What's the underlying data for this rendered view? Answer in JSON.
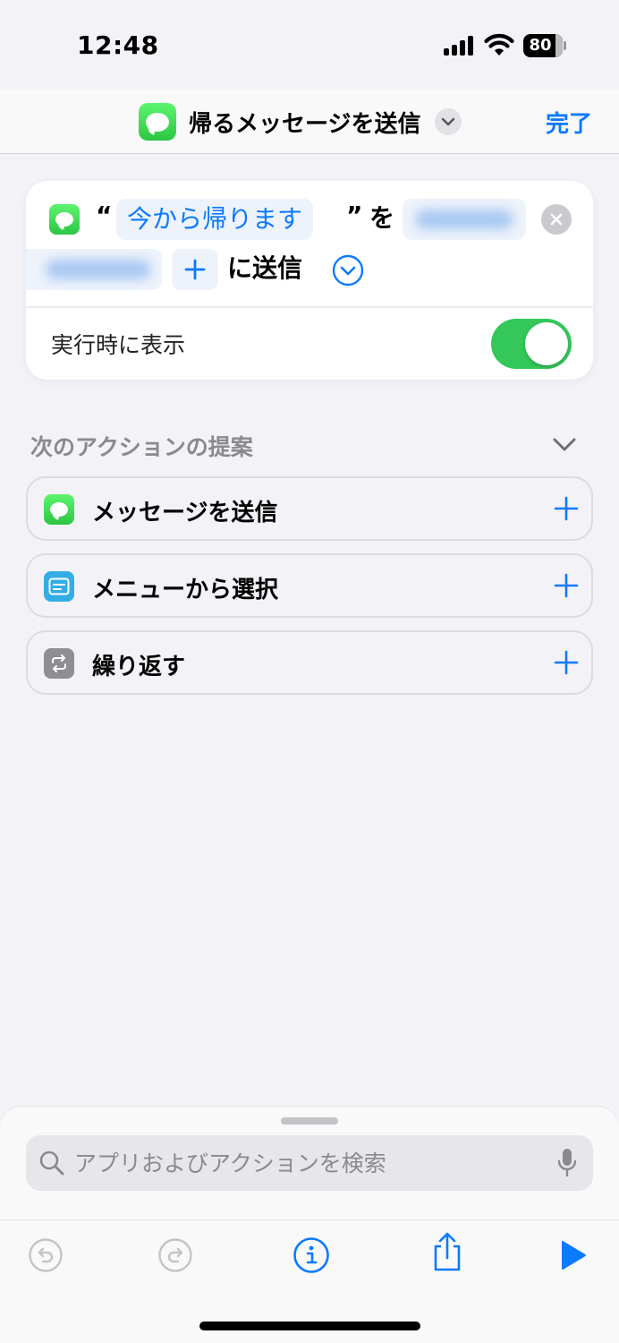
{
  "status_bar": {
    "time": "12:48",
    "battery": "80"
  },
  "nav": {
    "title": "帰るメッセージを送信",
    "done_label": "完了",
    "app_icon": "messages-icon"
  },
  "action": {
    "open_quote": "“",
    "message_text": "今から帰ります",
    "close_quote": "”",
    "particle_wo": "を",
    "send_to": "に送信",
    "show_when_run_label": "実行時に表示",
    "show_when_run_enabled": true
  },
  "suggestions": {
    "title": "次のアクションの提案",
    "items": [
      {
        "label": "メッセージを送信",
        "icon": "messages-icon",
        "color": "#34c759"
      },
      {
        "label": "メニューから選択",
        "icon": "menu-icon",
        "color": "#32ade6"
      },
      {
        "label": "繰り返す",
        "icon": "repeat-icon",
        "color": "#8e8e93"
      }
    ]
  },
  "search": {
    "placeholder": "アプリおよびアクションを検索"
  },
  "colors": {
    "accent": "#0a7aff",
    "toggle_on": "#34c759"
  }
}
